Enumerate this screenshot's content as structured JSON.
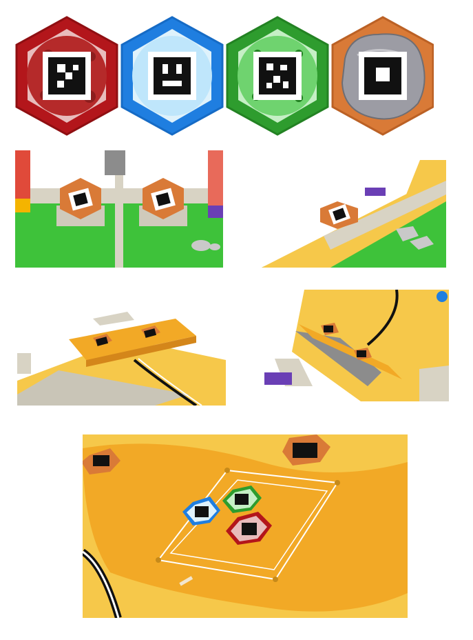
{
  "tiles": [
    {
      "name": "red",
      "fill": "#b3161b",
      "inner": "#c63a3a",
      "border": "#8f0f12",
      "icon": "red-planet-tile"
    },
    {
      "name": "blue",
      "fill": "#1f7ee0",
      "inner": "#bfe6fb",
      "border": "#166bc5",
      "icon": "ice-planet-tile"
    },
    {
      "name": "green",
      "fill": "#2e9c2e",
      "inner": "#6fd36f",
      "border": "#238223",
      "icon": "forest-planet-tile"
    },
    {
      "name": "orange",
      "fill": "#d97a37",
      "inner": "#9c9ca4",
      "border": "#bb6125",
      "icon": "rock-tile"
    }
  ],
  "colors": {
    "field_green": "#3ec23a",
    "field_yellow": "#f6c84a",
    "field_orange": "#f2a926",
    "wall": "#d8d3c4",
    "marker_black": "#111111"
  },
  "scenes": [
    {
      "id": "scene-goal-pedestals",
      "icon": "arena-goal-render"
    },
    {
      "id": "scene-corner-ramp",
      "icon": "arena-corner-render"
    },
    {
      "id": "scene-yellow-ramp-left",
      "icon": "arena-ramp-render"
    },
    {
      "id": "scene-yellow-ramp-right",
      "icon": "arena-ramp-render"
    },
    {
      "id": "scene-desert-zone",
      "icon": "desert-zone-render"
    }
  ]
}
